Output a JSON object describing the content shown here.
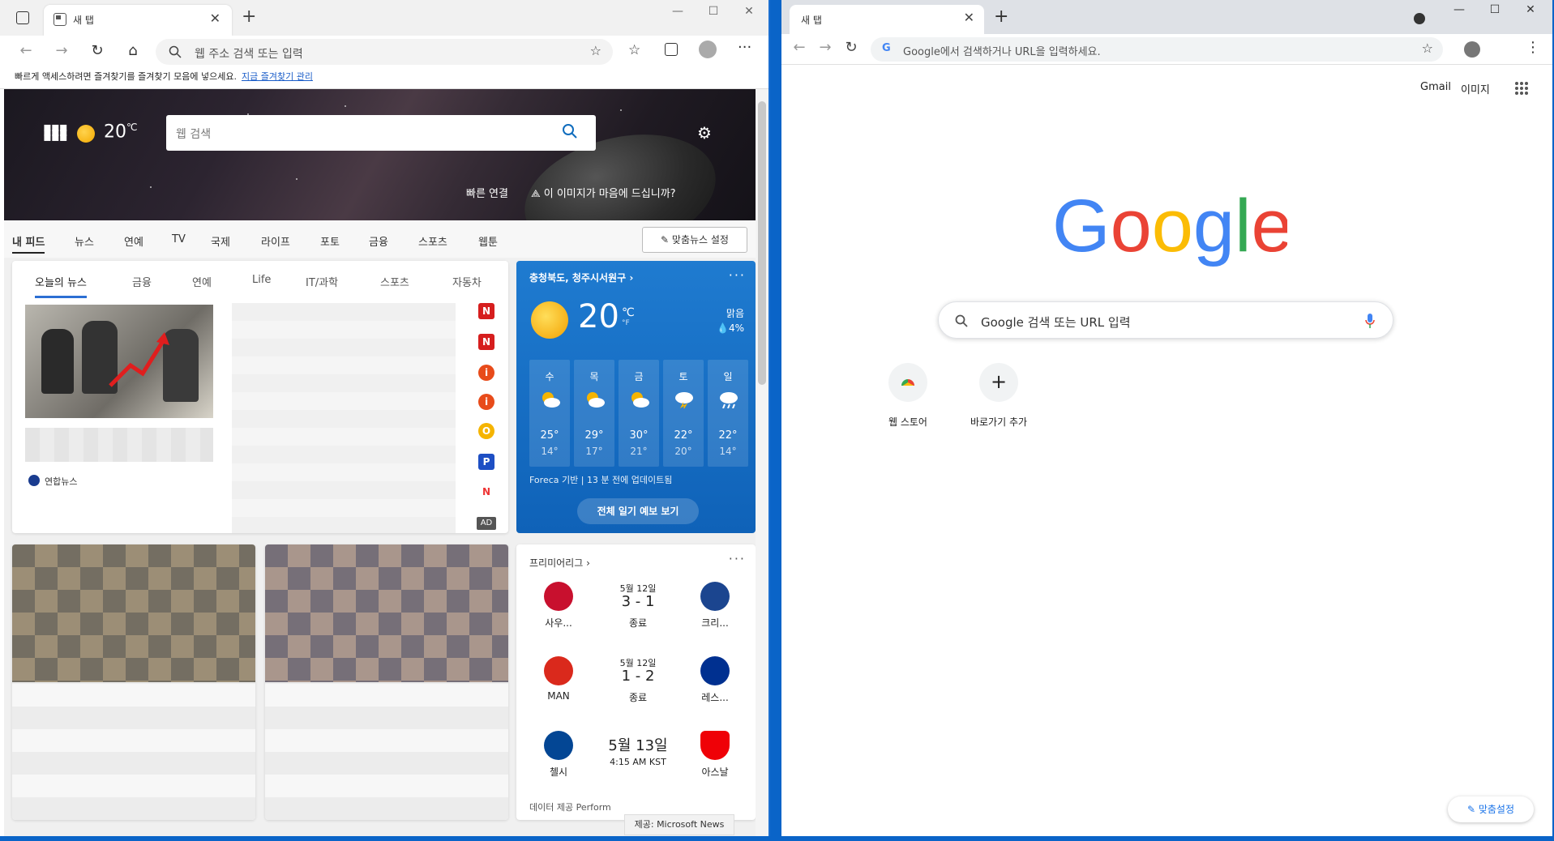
{
  "edge": {
    "tab_title": "새 탭",
    "address_placeholder": "웹 주소 검색 또는 입력",
    "fav_prompt": "빠르게 액세스하려면 즐겨찾기를 즐겨찾기 모음에 넣으세요.",
    "fav_link": "지금 즐겨찾기 관리",
    "hero": {
      "temp": "20",
      "temp_unit": "℃",
      "search_placeholder": "웹 검색",
      "quick_links": "빠른 연결",
      "like_image": "이 이미지가 마음에 드십니까?"
    },
    "feed_nav": [
      "내 피드",
      "뉴스",
      "연예",
      "TV",
      "국제",
      "라이프",
      "포토",
      "금융",
      "스포츠",
      "웹툰"
    ],
    "customize_label": "맞춤뉴스 설정",
    "news_tabs": [
      "오늘의 뉴스",
      "금융",
      "연예",
      "Life",
      "IT/과학",
      "스포츠",
      "자동차"
    ],
    "news_source": "연합뉴스",
    "ad_label": "AD",
    "weather": {
      "location": "충청북도, 청주시서원구",
      "temp": "20",
      "unit_c": "℃",
      "unit_f": "°F",
      "condition": "맑음",
      "precip": "4%",
      "days": [
        {
          "name": "수",
          "hi": "25°",
          "lo": "14°"
        },
        {
          "name": "목",
          "hi": "29°",
          "lo": "17°"
        },
        {
          "name": "금",
          "hi": "30°",
          "lo": "21°"
        },
        {
          "name": "토",
          "hi": "22°",
          "lo": "20°"
        },
        {
          "name": "일",
          "hi": "22°",
          "lo": "14°"
        }
      ],
      "updated": "Foreca 기반 | 13 분 전에 업데이트됨",
      "full_forecast": "전체 일기 예보 보기"
    },
    "soccer": {
      "header": "프리미어리그",
      "matches": [
        {
          "home": "사우...",
          "away": "크리...",
          "date": "5월 12일",
          "score": "3 - 1",
          "status": "종료"
        },
        {
          "home": "MAN",
          "away": "레스...",
          "date": "5월 12일",
          "score": "1 - 2",
          "status": "종료"
        },
        {
          "home": "첼시",
          "away": "아스날",
          "date": "5월 13일",
          "score": "",
          "status": "4:15 AM KST"
        }
      ],
      "provider": "데이터 제공 Perform"
    },
    "ms_news": "제공: Microsoft News"
  },
  "chrome": {
    "tab_title": "새 탭",
    "address_placeholder": "Google에서 검색하거나 URL을 입력하세요.",
    "gmail": "Gmail",
    "images": "이미지",
    "search_placeholder": "Google 검색 또는 URL 입력",
    "shortcuts": [
      {
        "label": "웹 스토어"
      },
      {
        "label": "바로가기 추가"
      }
    ],
    "customize": "맞춤설정"
  },
  "colors": {
    "edge_accent": "#2c6fd3",
    "weather_bg": "#1f7bd0",
    "google_blue": "#4285F4",
    "google_red": "#EA4335",
    "google_yellow": "#FBBC05",
    "google_green": "#34A853"
  }
}
